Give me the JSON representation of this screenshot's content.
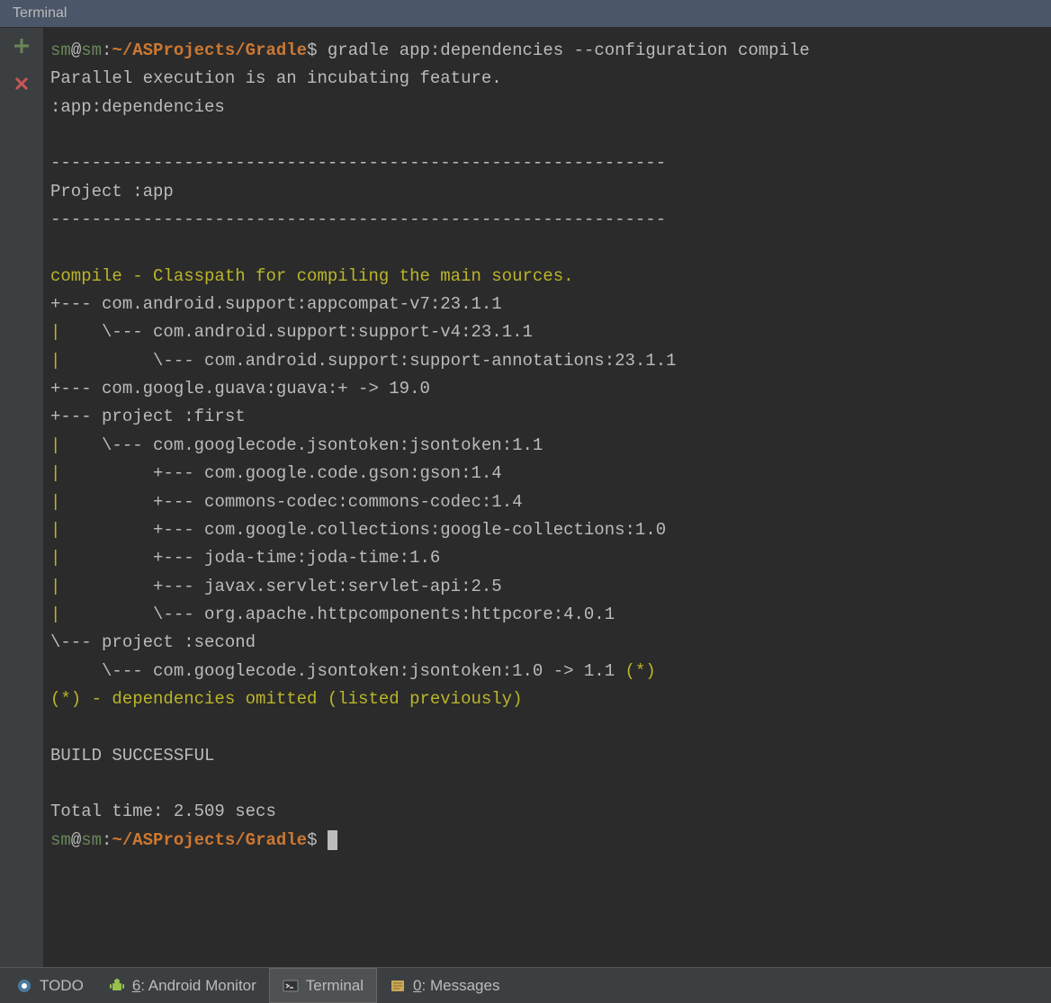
{
  "header": {
    "title": "Terminal"
  },
  "prompt": {
    "user": "sm",
    "at": "@",
    "host": "sm",
    "colon": ":",
    "path": "~/ASProjects/Gradle",
    "dollar": "$"
  },
  "command": "gradle app:dependencies --configuration compile",
  "output": {
    "line1": "Parallel execution is an incubating feature.",
    "line2": ":app:dependencies",
    "divider": "------------------------------------------------------------",
    "project_line": "Project :app",
    "compile_desc": "compile - Classpath for compiling the main sources.",
    "tree": [
      {
        "prefix": "+--- ",
        "text": "com.android.support:appcompat-v7:23.1.1"
      },
      {
        "pipe": "|    ",
        "prefix": "\\--- ",
        "text": "com.android.support:support-v4:23.1.1"
      },
      {
        "pipe": "|         ",
        "prefix": "\\--- ",
        "text": "com.android.support:support-annotations:23.1.1"
      },
      {
        "prefix": "+--- ",
        "text": "com.google.guava:guava:+ -> 19.0"
      },
      {
        "prefix": "+--- ",
        "text": "project :first"
      },
      {
        "pipe": "|    ",
        "prefix": "\\--- ",
        "text": "com.googlecode.jsontoken:jsontoken:1.1"
      },
      {
        "pipe": "|         ",
        "prefix": "+--- ",
        "text": "com.google.code.gson:gson:1.4"
      },
      {
        "pipe": "|         ",
        "prefix": "+--- ",
        "text": "commons-codec:commons-codec:1.4"
      },
      {
        "pipe": "|         ",
        "prefix": "+--- ",
        "text": "com.google.collections:google-collections:1.0"
      },
      {
        "pipe": "|         ",
        "prefix": "+--- ",
        "text": "joda-time:joda-time:1.6"
      },
      {
        "pipe": "|         ",
        "prefix": "+--- ",
        "text": "javax.servlet:servlet-api:2.5"
      },
      {
        "pipe": "|         ",
        "prefix": "\\--- ",
        "text": "org.apache.httpcomponents:httpcore:4.0.1"
      },
      {
        "prefix": "\\--- ",
        "text": "project :second"
      },
      {
        "pipe": "     ",
        "prefix": "\\--- ",
        "text": "com.googlecode.jsontoken:jsontoken:1.0 -> 1.1 ",
        "suffix": "(*)"
      }
    ],
    "omitted": "(*) - dependencies omitted (listed previously)",
    "build": "BUILD SUCCESSFUL",
    "total_time": "Total time: 2.509 secs"
  },
  "bottom_tabs": {
    "todo": "TODO",
    "android_num": "6",
    "android_label": ": Android Monitor",
    "terminal": "Terminal",
    "messages_num": "0",
    "messages_label": ": Messages"
  }
}
